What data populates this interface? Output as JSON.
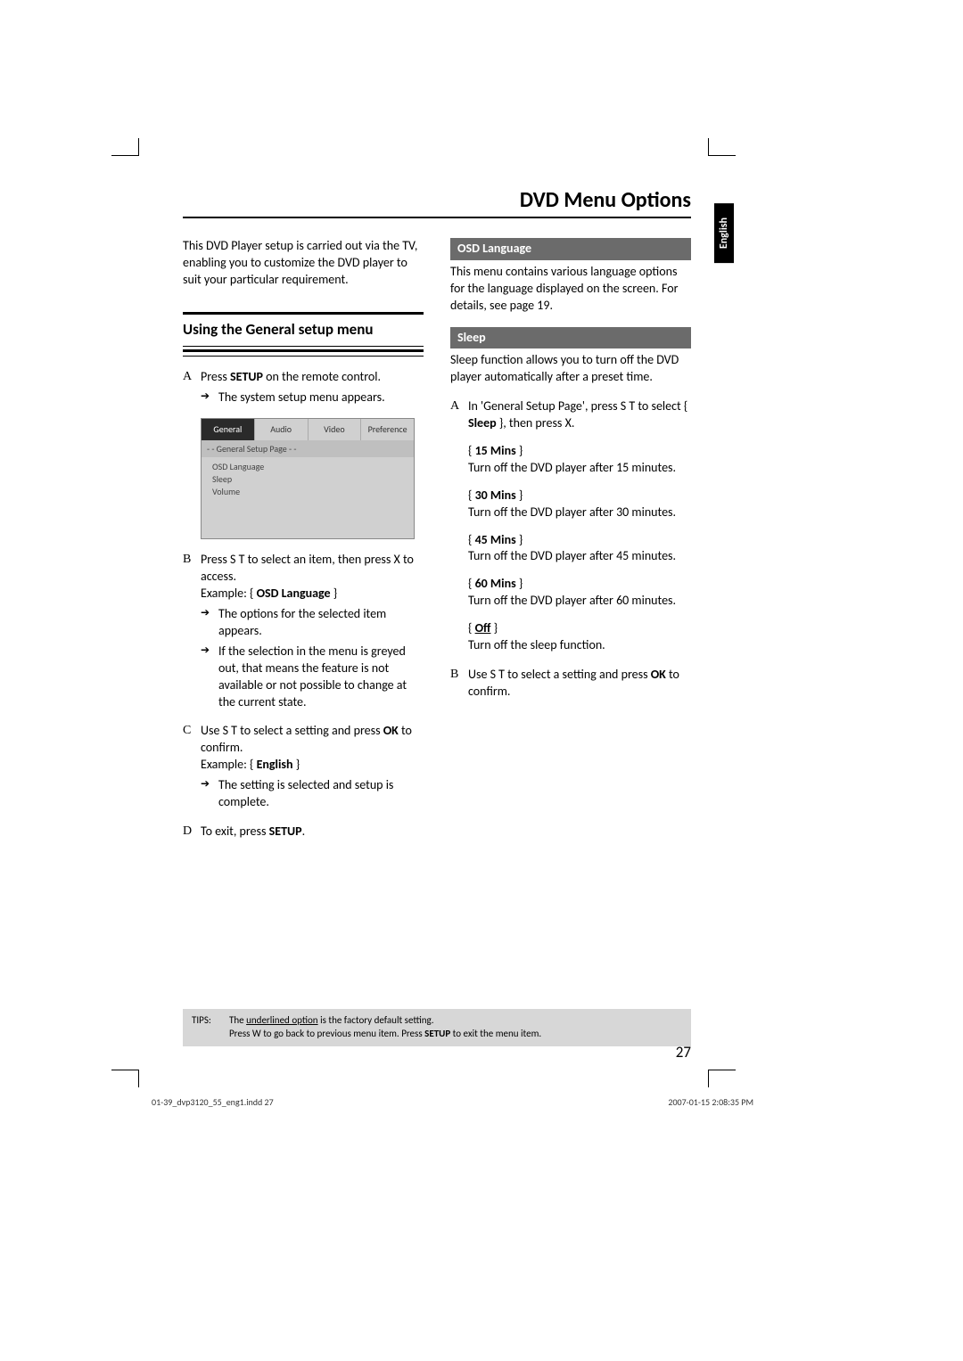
{
  "pageTitle": "DVD Menu Options",
  "langTab": "English",
  "pageNumber": "27",
  "intro": "This DVD Player setup is carried out via the TV, enabling you to customize the DVD player to suit your particular requirement.",
  "sectionTitle": "Using the General setup menu",
  "steps": {
    "a_marker": "A",
    "a_pre": "Press ",
    "a_bold": "SETUP",
    "a_post": " on the remote control.",
    "a_sub": "The system setup menu appears.",
    "b_marker": "B",
    "b_text": "Press  S  T  to select an item, then press  X to access.",
    "b_ex_pre": "Example: { ",
    "b_ex_bold": "OSD Language",
    "b_ex_post": " }",
    "b_sub1": "The options for the selected item appears.",
    "b_sub2": "If the selection in the menu is greyed out, that means the feature is not available or not possible to change at the current state.",
    "c_marker": "C",
    "c_pre": "Use  S  T  to select a setting and press ",
    "c_bold": "OK",
    "c_post": " to confirm.",
    "c_ex_pre": "Example: { ",
    "c_ex_bold": "English",
    "c_ex_post": " }",
    "c_sub": "The setting is selected and setup is complete.",
    "d_marker": "D",
    "d_pre": "To exit, press ",
    "d_bold": "SETUP",
    "d_post": "."
  },
  "osd": {
    "tabs": [
      "General",
      "Audio",
      "Video",
      "Preference"
    ],
    "header": "- -   General Setup Page   - -",
    "items": [
      "OSD Language",
      "Sleep",
      "Volume"
    ]
  },
  "osdLang": {
    "title": "OSD Language",
    "body": "This menu contains various language options for the language displayed on the screen. For details, see page 19."
  },
  "sleep": {
    "title": "Sleep",
    "body": "Sleep function allows you to turn off the DVD player automatically after a preset time.",
    "a_marker": "A",
    "a_pre": "In 'General Setup Page', press  S  T  to select { ",
    "a_bold": "Sleep",
    "a_post": " }, then press  X.",
    "opts": [
      {
        "label": "15 Mins",
        "underline": false,
        "desc": "Turn off the DVD player after 15 minutes."
      },
      {
        "label": "30 Mins",
        "underline": false,
        "desc": "Turn off the DVD player after 30 minutes."
      },
      {
        "label": "45 Mins",
        "underline": false,
        "desc": "Turn off the DVD player after 45 minutes."
      },
      {
        "label": "60 Mins",
        "underline": false,
        "desc": "Turn off the DVD player after 60 minutes."
      },
      {
        "label": "Off",
        "underline": true,
        "desc": "Turn off the sleep function."
      }
    ],
    "b_marker": "B",
    "b_pre": "Use  S  T  to select a setting and press ",
    "b_bold": "OK",
    "b_post": " to confirm."
  },
  "tips": {
    "label": "TIPS:",
    "line1_pre": "The ",
    "line1_u": "underlined option",
    "line1_post": " is the factory default setting.",
    "line2_pre": "Press  W to go back to previous menu item. Press ",
    "line2_bold": "SETUP",
    "line2_post": " to exit the menu item."
  },
  "footer": {
    "left": "01-39_dvp3120_55_eng1.indd   27",
    "right": "2007-01-15   2:08:35 PM"
  }
}
